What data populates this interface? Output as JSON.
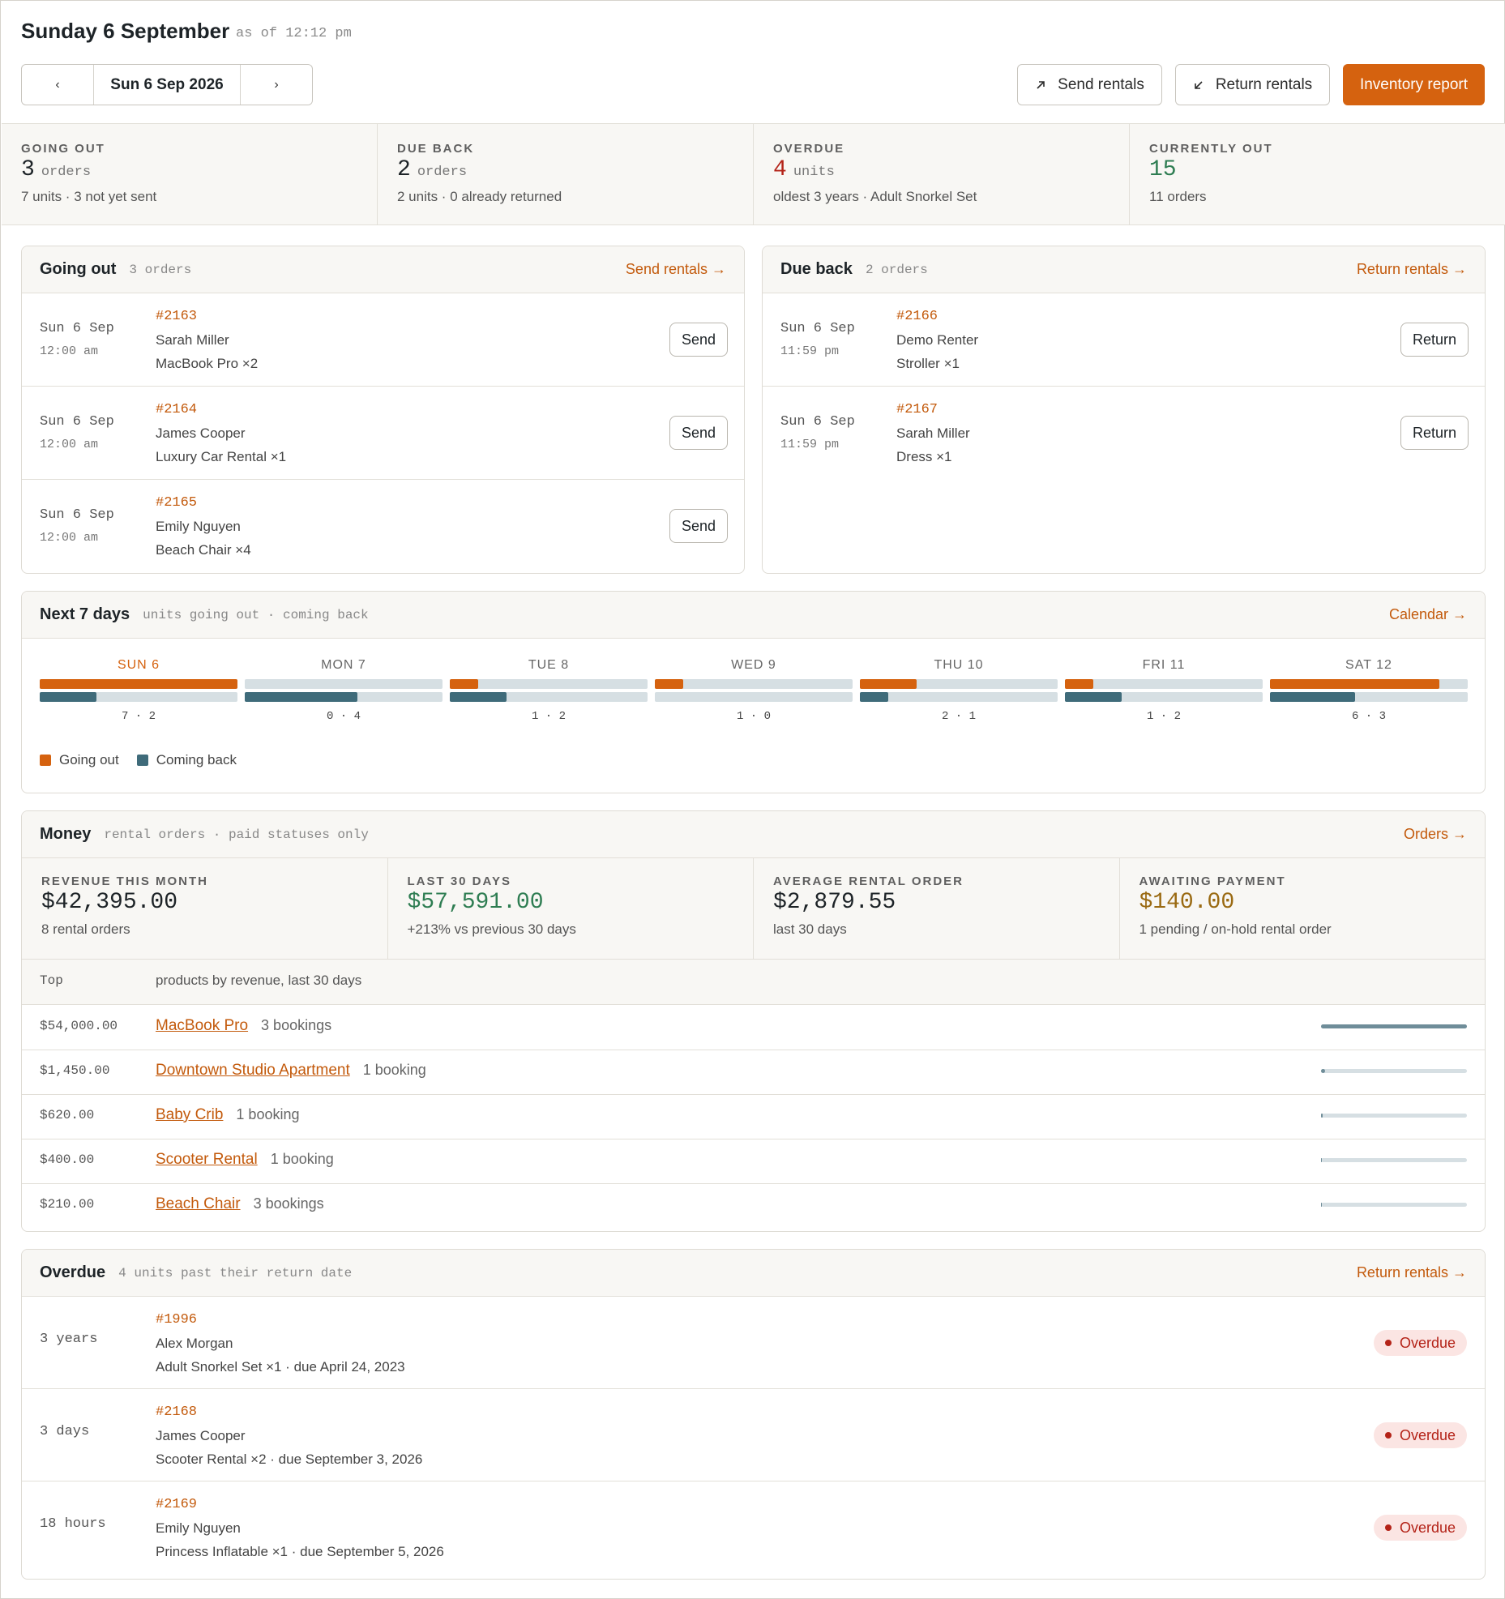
{
  "header": {
    "title": "Sunday 6 September",
    "as_of": "as of 12:12 pm",
    "prev_label": "‹",
    "next_label": "›",
    "current_date": "Sun 6 Sep 2026",
    "send_label": "Send rentals",
    "return_label": "Return rentals",
    "inventory_label": "Inventory report"
  },
  "stats": [
    {
      "label": "GOING OUT",
      "value": "3",
      "unit": "orders",
      "sub": "7 units · 3 not yet sent"
    },
    {
      "label": "DUE BACK",
      "value": "2",
      "unit": "orders",
      "sub": "2 units · 0 already returned"
    },
    {
      "label": "OVERDUE",
      "value": "4",
      "unit": "units",
      "sub": "oldest 3 years · Adult Snorkel Set"
    },
    {
      "label": "CURRENTLY OUT",
      "value": "15",
      "unit": "",
      "sub": "11 orders"
    }
  ],
  "going_out": {
    "title": "Going out",
    "subtitle": "3 orders",
    "link": "Send rentals →",
    "rows": [
      {
        "date": "Sun 6 Sep",
        "time": "12:00 am",
        "order": "#2163",
        "customer": "Sarah Miller",
        "item": "MacBook Pro ×2",
        "action": "Send"
      },
      {
        "date": "Sun 6 Sep",
        "time": "12:00 am",
        "order": "#2164",
        "customer": "James Cooper",
        "item": "Luxury Car Rental ×1",
        "action": "Send"
      },
      {
        "date": "Sun 6 Sep",
        "time": "12:00 am",
        "order": "#2165",
        "customer": "Emily Nguyen",
        "item": "Beach Chair ×4",
        "action": "Send"
      }
    ]
  },
  "due_back": {
    "title": "Due back",
    "subtitle": "2 orders",
    "link": "Return rentals →",
    "rows": [
      {
        "date": "Sun 6 Sep",
        "time": "11:59 pm",
        "order": "#2166",
        "customer": "Demo Renter",
        "item": "Stroller ×1",
        "action": "Return"
      },
      {
        "date": "Sun 6 Sep",
        "time": "11:59 pm",
        "order": "#2167",
        "customer": "Sarah Miller",
        "item": "Dress ×1",
        "action": "Return"
      }
    ]
  },
  "next7": {
    "title": "Next 7 days",
    "subtitle": "units going out · coming back",
    "link": "Calendar →",
    "max_units": 7,
    "days": [
      {
        "label": "SUN 6",
        "out": 7,
        "back": 2,
        "counts": "7 · 2",
        "today": true
      },
      {
        "label": "MON 7",
        "out": 0,
        "back": 4,
        "counts": "0 · 4",
        "today": false
      },
      {
        "label": "TUE 8",
        "out": 1,
        "back": 2,
        "counts": "1 · 2",
        "today": false
      },
      {
        "label": "WED 9",
        "out": 1,
        "back": 0,
        "counts": "1 · 0",
        "today": false
      },
      {
        "label": "THU 10",
        "out": 2,
        "back": 1,
        "counts": "2 · 1",
        "today": false
      },
      {
        "label": "FRI 11",
        "out": 1,
        "back": 2,
        "counts": "1 · 2",
        "today": false
      },
      {
        "label": "SAT 12",
        "out": 6,
        "back": 3,
        "counts": "6 · 3",
        "today": false
      }
    ],
    "legend_out": "Going out",
    "legend_back": "Coming back",
    "colors": {
      "out": "#d5620f",
      "back": "#3f6b7a",
      "track": "#d6dfe3"
    }
  },
  "money": {
    "title": "Money",
    "subtitle": "rental orders · paid statuses only",
    "link": "Orders →",
    "stats": [
      {
        "label": "REVENUE THIS MONTH",
        "value": "$42,395.00",
        "sub": "8 rental orders"
      },
      {
        "label": "LAST 30 DAYS",
        "value": "$57,591.00",
        "sub": "+213% vs previous 30 days"
      },
      {
        "label": "AVERAGE RENTAL ORDER",
        "value": "$2,879.55",
        "sub": "last 30 days"
      },
      {
        "label": "AWAITING PAYMENT",
        "value": "$140.00",
        "sub": "1 pending / on-hold rental order"
      }
    ],
    "top_label": "Top",
    "top_desc": "products by revenue, last 30 days",
    "products": [
      {
        "amount": "$54,000.00",
        "revenue": 54000,
        "name": "MacBook Pro",
        "bookings": "3 bookings"
      },
      {
        "amount": "$1,450.00",
        "revenue": 1450,
        "name": "Downtown Studio Apartment",
        "bookings": "1 booking"
      },
      {
        "amount": "$620.00",
        "revenue": 620,
        "name": "Baby Crib",
        "bookings": "1 booking"
      },
      {
        "amount": "$400.00",
        "revenue": 400,
        "name": "Scooter Rental",
        "bookings": "1 booking"
      },
      {
        "amount": "$210.00",
        "revenue": 210,
        "name": "Beach Chair",
        "bookings": "3 bookings"
      }
    ]
  },
  "overdue": {
    "title": "Overdue",
    "subtitle": "4 units past their return date",
    "link": "Return rentals →",
    "rows": [
      {
        "age": "3 years",
        "order": "#1996",
        "customer": "Alex Morgan",
        "item": "Adult Snorkel Set ×1 · due April 24, 2023",
        "badge": "Overdue"
      },
      {
        "age": "3 days",
        "order": "#2168",
        "customer": "James Cooper",
        "item": "Scooter Rental ×2 · due September 3, 2026",
        "badge": "Overdue"
      },
      {
        "age": "18 hours",
        "order": "#2169",
        "customer": "Emily Nguyen",
        "item": "Princess Inflatable ×1 · due September 5, 2026",
        "badge": "Overdue"
      }
    ]
  },
  "colors": {
    "accent": "#d5620f",
    "link": "#c35a0c",
    "danger": "#b42318",
    "positive": "#2e7d52",
    "pending": "#9a6a12"
  }
}
